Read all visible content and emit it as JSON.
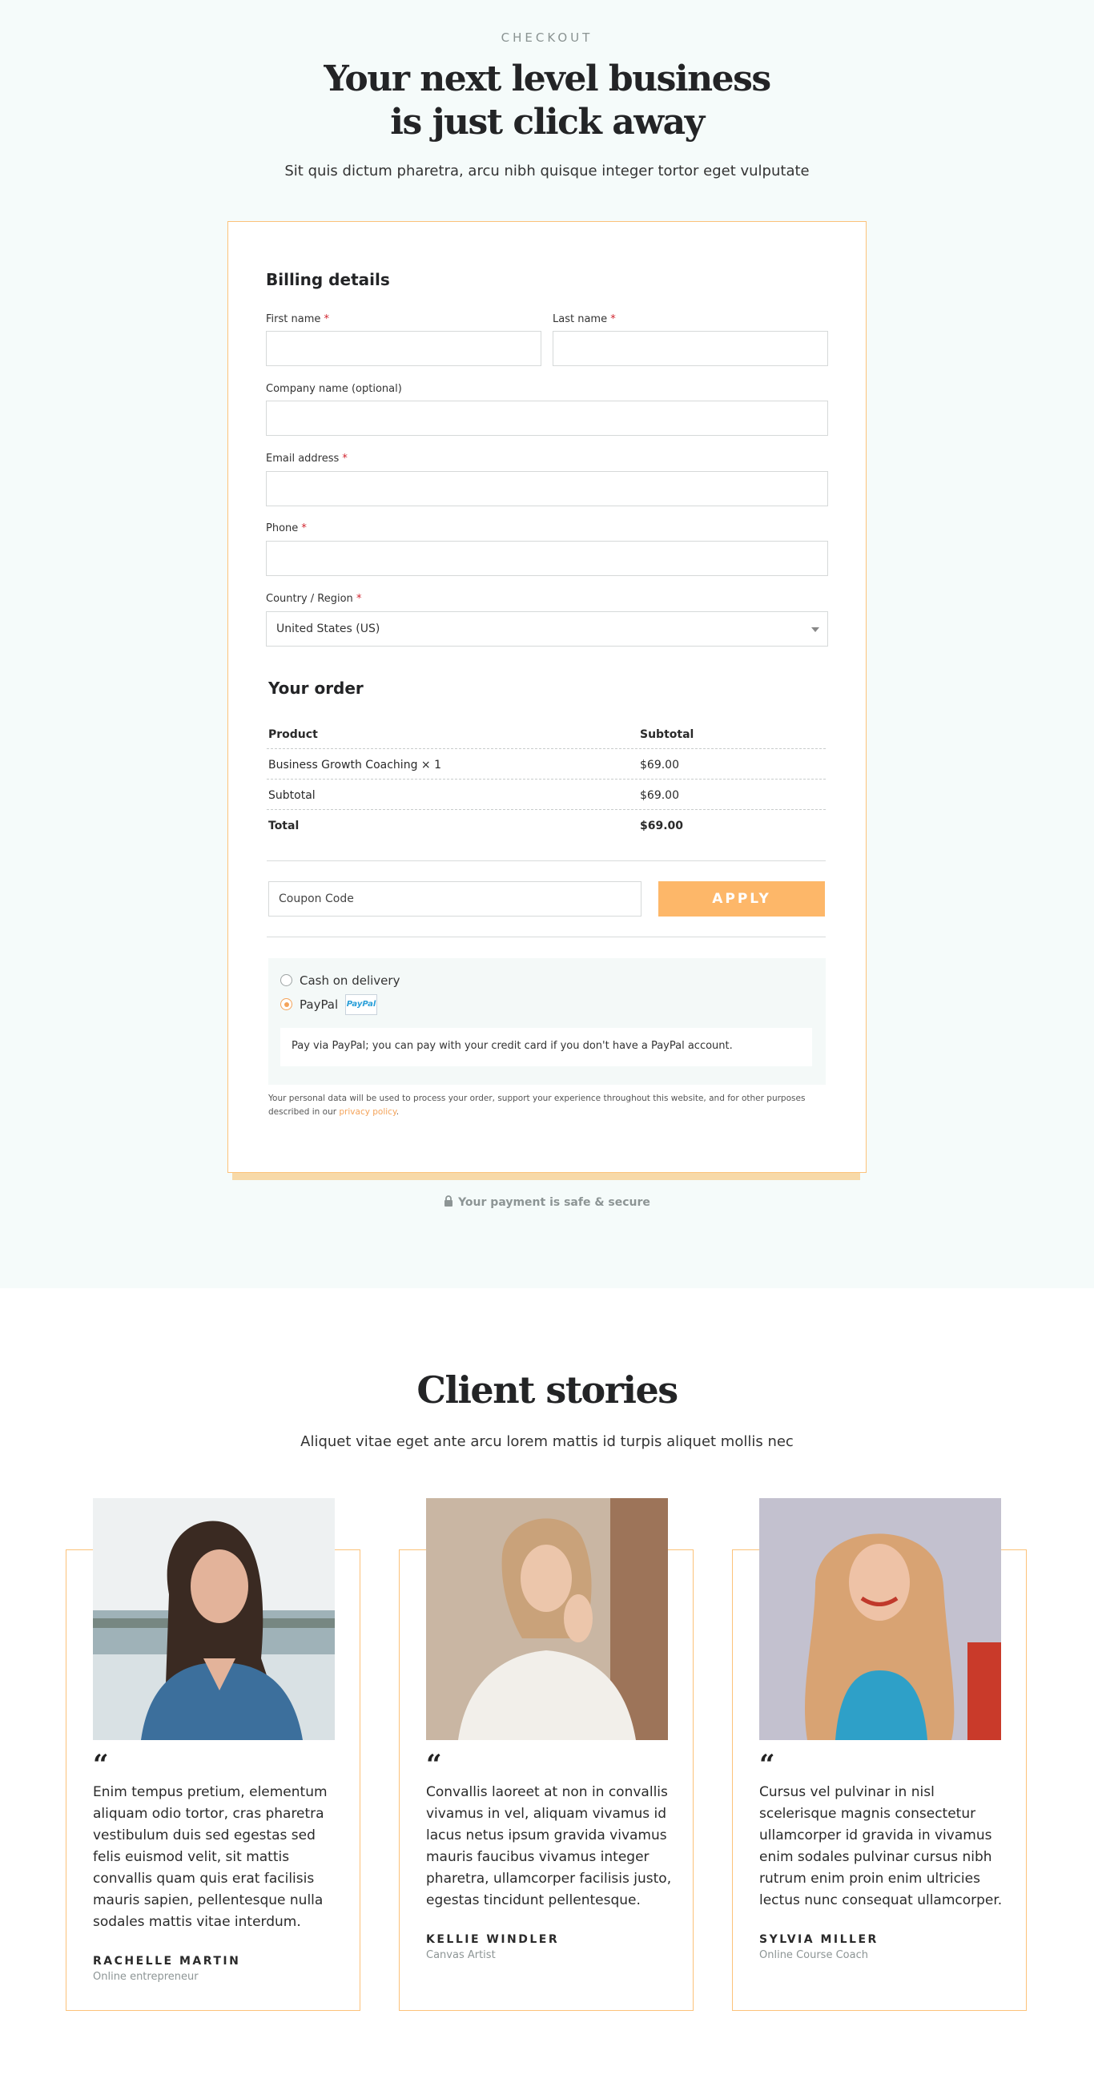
{
  "header": {
    "eyebrow": "CHECKOUT",
    "title": "Your next level business is just click away",
    "subtitle": "Sit quis dictum pharetra, arcu nibh quisque integer tortor eget vulputate"
  },
  "billing": {
    "title": "Billing details",
    "first_name_label": "First name",
    "last_name_label": "Last name",
    "company_label": "Company name (optional)",
    "email_label": "Email address",
    "phone_label": "Phone",
    "country_label": "Country / Region",
    "country_value": "United States (US)",
    "required_mark": "*"
  },
  "order": {
    "title": "Your order",
    "col_product": "Product",
    "col_subtotal": "Subtotal",
    "rows": [
      {
        "label": "Business Growth Coaching × 1",
        "value": "$69.00"
      },
      {
        "label": "Subtotal",
        "value": "$69.00"
      },
      {
        "label": "Total",
        "value": "$69.00"
      }
    ]
  },
  "coupon": {
    "placeholder": "Coupon Code",
    "apply_label": "APPLY"
  },
  "payment": {
    "options": [
      {
        "label": "Cash on delivery",
        "selected": false
      },
      {
        "label": "PayPal",
        "selected": true
      }
    ],
    "paypal_logo": "PayPal",
    "paypal_note": "Pay via PayPal; you can pay with your credit card if you don't have a PayPal account.",
    "privacy_text": "Your personal data will be used to process your order, support your experience throughout this website, and for other purposes described in our",
    "privacy_link": "privacy policy",
    "privacy_end": "."
  },
  "secure_text": "Your payment is safe & secure",
  "stories": {
    "title": "Client stories",
    "subtitle": "Aliquet vitae eget ante arcu lorem mattis id turpis aliquet mollis nec",
    "quote_mark": "“",
    "items": [
      {
        "quote": "Enim tempus pretium, elementum aliquam odio tortor, cras pharetra vestibulum duis sed egestas sed felis euismod velit, sit mattis convallis quam quis erat facilisis mauris sapien, pellentesque nulla sodales mattis vitae interdum.",
        "name": "RACHELLE MARTIN",
        "role": "Online entrepreneur"
      },
      {
        "quote": "Convallis laoreet at non in convallis vivamus in vel, aliquam vivamus id lacus netus ipsum gravida vivamus mauris faucibus vivamus integer pharetra, ullamcorper facilisis justo, egestas tincidunt pellentesque.",
        "name": "KELLIE WINDLER",
        "role": "Canvas Artist"
      },
      {
        "quote": "Cursus vel pulvinar in nisl scelerisque magnis consectetur ullamcorper id gravida in vivamus enim sodales pulvinar cursus nibh rutrum enim proin enim ultricies lectus nunc consequat ullamcorper.",
        "name": "SYLVIA MILLER",
        "role": "Online Course Coach"
      }
    ]
  },
  "colors": {
    "accent": "#fdb769",
    "card_border": "#fcc27a",
    "hero_bg": "#f5fbfa",
    "required": "#d1242f"
  }
}
